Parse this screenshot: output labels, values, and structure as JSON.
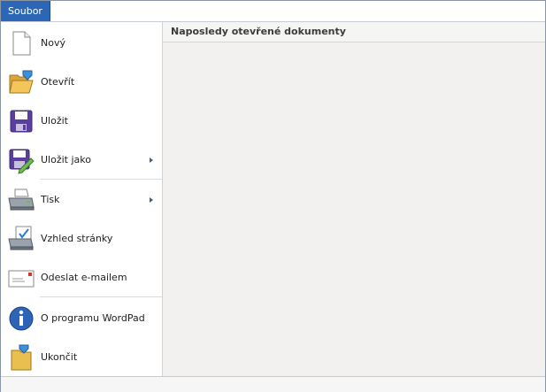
{
  "tab": {
    "label": "Soubor"
  },
  "menu": {
    "items": [
      {
        "label": "Nový",
        "icon": "new-document-icon"
      },
      {
        "label": "Otevřít",
        "icon": "open-folder-icon"
      },
      {
        "label": "Uložit",
        "icon": "save-disk-icon"
      },
      {
        "label": "Uložit jako",
        "icon": "save-as-icon",
        "submenu": true
      },
      {
        "label": "Tisk",
        "icon": "printer-icon",
        "submenu": true
      },
      {
        "label": "Vzhled stránky",
        "icon": "page-setup-icon"
      },
      {
        "label": "Odeslat e-mailem",
        "icon": "email-envelope-icon"
      },
      {
        "label": "O programu WordPad",
        "icon": "info-icon"
      },
      {
        "label": "Ukončit",
        "icon": "exit-icon"
      }
    ]
  },
  "recent": {
    "title": "Naposledy otevřené dokumenty"
  },
  "colors": {
    "accent": "#2c66b6",
    "menu_bg": "#ffffff",
    "panel_bg": "#f2f1f0"
  }
}
